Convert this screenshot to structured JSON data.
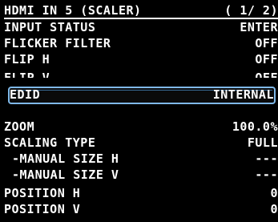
{
  "header": {
    "title": "HDMI IN 5 (SCALER)",
    "page": "( 1/ 2)"
  },
  "rows": [
    {
      "label": "INPUT STATUS",
      "value": "ENTER"
    },
    {
      "label": "FLICKER FILTER",
      "value": "OFF"
    },
    {
      "label": "FLIP H",
      "value": "OFF"
    },
    {
      "label": "FLIP V",
      "value": "OFF"
    },
    {
      "label": "EDID",
      "value": "INTERNAL"
    },
    {
      "label": "ZOOM",
      "value": "100.0%"
    },
    {
      "label": "SCALING TYPE",
      "value": "FULL"
    },
    {
      "label": "-MANUAL SIZE H",
      "value": "---"
    },
    {
      "label": "-MANUAL SIZE V",
      "value": "---"
    },
    {
      "label": "POSITION H",
      "value": "0"
    },
    {
      "label": "POSITION V",
      "value": "0"
    }
  ],
  "colors": {
    "background": "#000000",
    "text": "#ffffff",
    "selection_border": "#7fb8e8"
  }
}
